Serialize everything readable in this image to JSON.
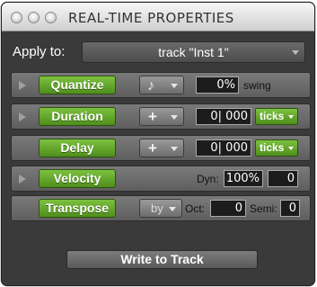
{
  "window": {
    "title": "REAL-TIME PROPERTIES"
  },
  "apply_to": {
    "label": "Apply to:",
    "value": "track \"Inst 1\""
  },
  "rows": {
    "quantize": {
      "button": "Quantize",
      "note_icon": "eighth-note-icon",
      "value": "0%",
      "unit": "swing"
    },
    "duration": {
      "button": "Duration",
      "sign": "+",
      "value": "0| 000",
      "unit": "ticks"
    },
    "delay": {
      "button": "Delay",
      "sign": "+",
      "value": "0| 000",
      "unit": "ticks"
    },
    "velocity": {
      "button": "Velocity",
      "dyn_label": "Dyn:",
      "dyn_value": "100%",
      "offset": "0"
    },
    "transpose": {
      "button": "Transpose",
      "mode": "by",
      "oct_label": "Oct:",
      "oct_value": "0",
      "semi_label": "Semi:",
      "semi_value": "0"
    }
  },
  "footer": {
    "write_button": "Write to Track"
  },
  "colors": {
    "accent_green": "#5fa62a",
    "panel": "#3a3a3a"
  }
}
